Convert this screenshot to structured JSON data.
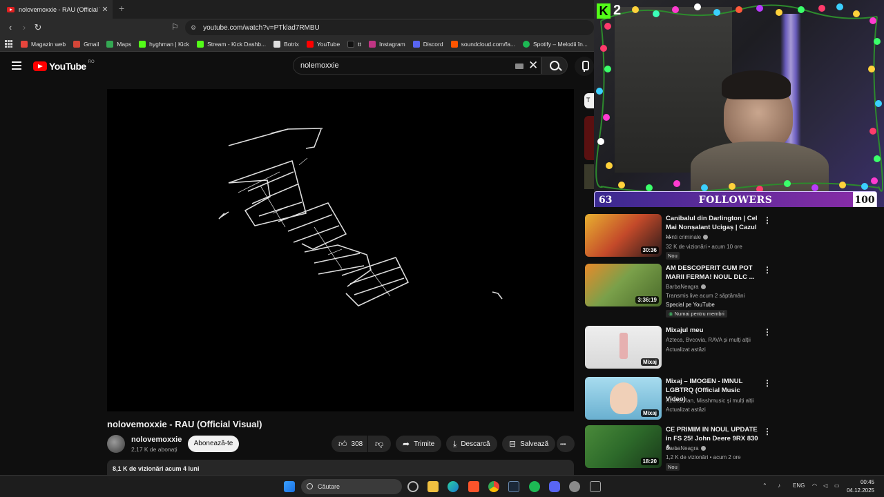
{
  "browser": {
    "tab_title": "nolovemoxxie - RAU (Official Vis",
    "tab_close": "✕",
    "new_tab": "+",
    "url": "youtube.com/watch?v=PTklad7RMBU",
    "bookmarks": [
      {
        "label": "Magazin web",
        "color": "#e8453c"
      },
      {
        "label": "Gmail",
        "color": "#d44638"
      },
      {
        "label": "Maps",
        "color": "#34a853"
      },
      {
        "label": "hyghman | Kick",
        "color": "#53fc18"
      },
      {
        "label": "Stream - Kick Dashb...",
        "color": "#53fc18"
      },
      {
        "label": "Botrix",
        "color": "#e0e0e0"
      },
      {
        "label": "YouTube",
        "color": "#ff0000"
      },
      {
        "label": "tt",
        "color": "#111111"
      },
      {
        "label": "Instagram",
        "color": "#c13584"
      },
      {
        "label": "Discord",
        "color": "#5865f2"
      },
      {
        "label": "soundcloud.com/fa...",
        "color": "#ff5500"
      },
      {
        "label": "Spotify – Melodii în...",
        "color": "#1db954"
      }
    ]
  },
  "youtube": {
    "logo_text": "YouTube",
    "country": "RO",
    "search_value": "nolemoxxie",
    "video_title": "nolovemoxxie - RAU (Official Visual)",
    "channel_name": "nolovemoxxie",
    "channel_subs": "2,17 K de abonați",
    "subscribe_label": "Abonează-te",
    "likes": "308",
    "share_label": "Trimite",
    "download_label": "Descarcă",
    "save_label": "Salvează",
    "description_meta": "8,1 K de vizionări  acum 4 luni",
    "more": "•••",
    "peek_letter": "T"
  },
  "recommendations": [
    {
      "title": "Canibalul din Darlington | Cel Mai Nonșalant Ucigaș | Cazul ...",
      "channel": "Minti criminale",
      "verified": true,
      "meta": "32 K de vizionări • acum 10 ore",
      "badge": "Nou",
      "duration": "30:36",
      "thumb": "#c44a2a"
    },
    {
      "title": "AM DESCOPERIT CUM POT MARII FERMA! NOUL DLC ...",
      "channel": "BarbaNeagra",
      "verified": true,
      "meta": "Transmis live acum 2 săptămâni",
      "extra": "Special pe YouTube",
      "members": "Numai pentru membri",
      "duration": "3:36:19",
      "thumb": "#6a8a3a"
    },
    {
      "title": "Mixajul meu",
      "channel": "Azteca, Bvcovia, RAVA și mulți alții",
      "meta": "Actualizat astăzi",
      "duration": "Mixaj",
      "thumb": "#d8d8d8"
    },
    {
      "title": "Mixaj – IMOGEN - IMNUL LGBTRQ (Official Music Video)",
      "channel": "Azteca, Ian, Misshmusic și mulți alții",
      "meta": "Actualizat astăzi",
      "duration": "Mixaj",
      "thumb": "#8fc8e0"
    },
    {
      "title": "CE PRIMIM IN NOUL UPDATE in FS 25! John Deere 9RX 830 & ...",
      "channel": "BarbaNeagra",
      "verified": true,
      "meta": "1,2 K de vizionări • acum 2 ore",
      "badge": "Nou",
      "duration": "18:20",
      "thumb": "#2d6a2a"
    }
  ],
  "stream_overlay": {
    "kick_letter": "K",
    "viewer_count": "2",
    "followers_current": "63",
    "followers_label": "FOLLOWERS",
    "followers_goal": "100"
  },
  "taskbar": {
    "search_placeholder": "Căutare",
    "language": "ENG",
    "time": "00:45",
    "date": "04.12.2025"
  }
}
